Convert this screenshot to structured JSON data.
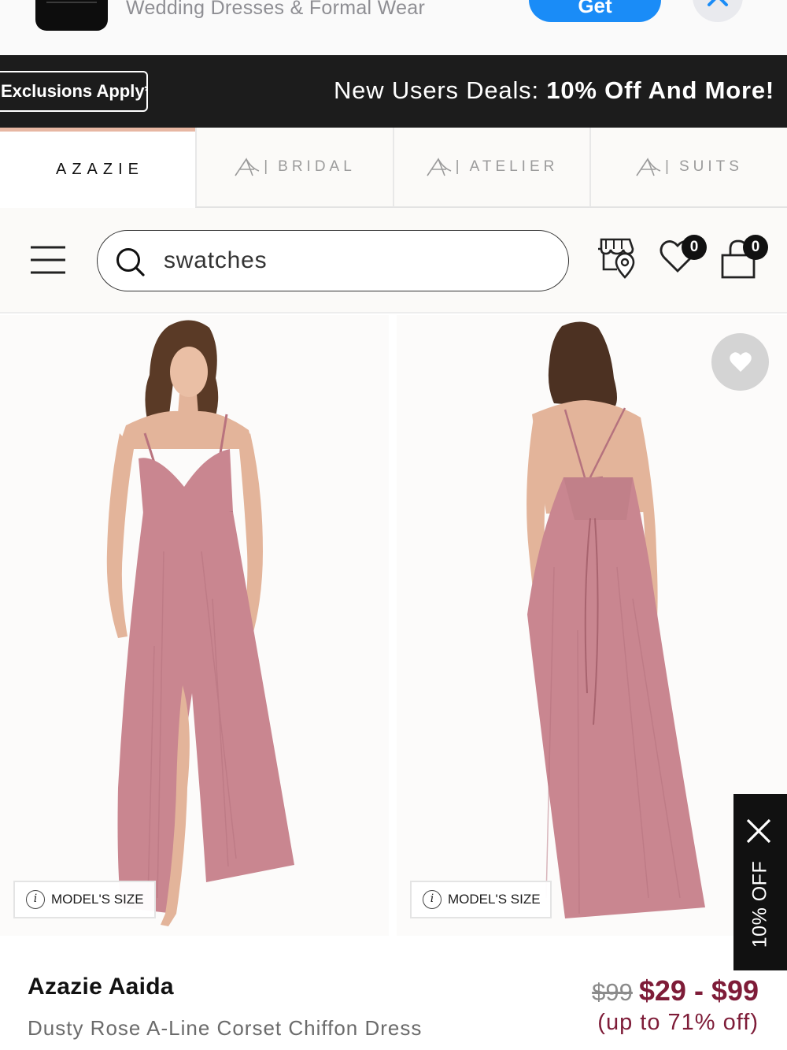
{
  "app_banner": {
    "subtitle": "Wedding Dresses & Formal Wear",
    "get_label": "Get"
  },
  "promo": {
    "exclusions": "Exclusions Apply*",
    "deal_prefix": "New Users Deals:",
    "deal_highlight": "10% Off And More!"
  },
  "brand_tabs": [
    {
      "label": "AZAZIE",
      "active": true
    },
    {
      "label": "BRIDAL",
      "active": false
    },
    {
      "label": "ATELIER",
      "active": false
    },
    {
      "label": "SUITS",
      "active": false
    }
  ],
  "search": {
    "value": "swatches"
  },
  "header": {
    "wishlist_count": "0",
    "cart_count": "0"
  },
  "gallery": {
    "model_size_label": "MODEL'S SIZE",
    "offer_tab_label": "10% OFF"
  },
  "product": {
    "name": "Azazie Aaida",
    "description": "Dusty Rose A-Line Corset Chiffon Dress",
    "price_original": "$99",
    "price_range": "$29 - $99",
    "discount": "(up to 71% off)"
  },
  "colors": {
    "accent": "#7e1c38",
    "dress": "#c98690",
    "promo_bg": "#1c1c1c",
    "tab_accent": "#e7b7a3"
  }
}
